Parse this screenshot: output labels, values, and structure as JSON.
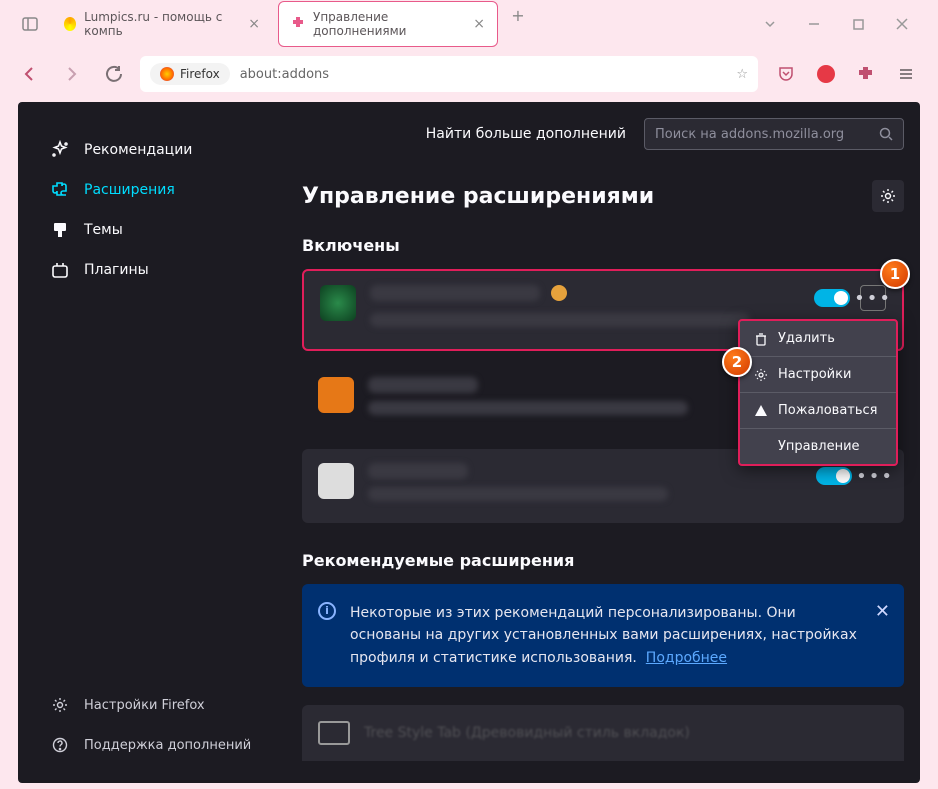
{
  "window": {
    "tabs": [
      {
        "label": "Lumpics.ru - помощь с компь"
      },
      {
        "label": "Управление дополнениями"
      }
    ],
    "url_prefix": "Firefox",
    "url": "about:addons"
  },
  "sidebar": {
    "items": [
      {
        "label": "Рекомендации"
      },
      {
        "label": "Расширения"
      },
      {
        "label": "Темы"
      },
      {
        "label": "Плагины"
      }
    ],
    "bottom": [
      {
        "label": "Настройки Firefox"
      },
      {
        "label": "Поддержка дополнений"
      }
    ]
  },
  "search": {
    "label": "Найти больше дополнений",
    "placeholder": "Поиск на addons.mozilla.org"
  },
  "main": {
    "title": "Управление расширениями",
    "section_enabled": "Включены",
    "section_recommended": "Рекомендуемые расширения",
    "recommended_item": "Tree Style Tab (Древовидный стиль вкладок)"
  },
  "context_menu": {
    "items": [
      {
        "label": "Удалить",
        "icon": "trash"
      },
      {
        "label": "Настройки",
        "icon": "gear"
      },
      {
        "label": "Пожаловаться",
        "icon": "warn"
      },
      {
        "label": "Управление",
        "icon": ""
      }
    ]
  },
  "callouts": {
    "one": "1",
    "two": "2"
  },
  "info": {
    "text_a": "Некоторые из этих рекомендаций персонализированы. Они основаны на других установленных вами расширениях, настройках профиля и статистике использования.",
    "link": "Подробнее"
  }
}
